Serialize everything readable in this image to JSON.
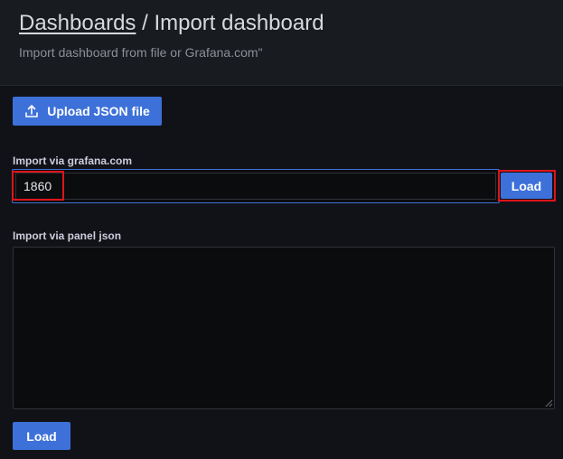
{
  "header": {
    "breadcrumb_link": "Dashboards",
    "separator": " / ",
    "page_title": "Import dashboard",
    "subtitle": "Import dashboard from file or Grafana.com\""
  },
  "upload": {
    "label": "Upload JSON file",
    "icon": "upload-icon"
  },
  "grafana_import": {
    "label": "Import via grafana.com",
    "value": "1860",
    "load_label": "Load"
  },
  "panel_json": {
    "label": "Import via panel json",
    "value": "",
    "load_label": "Load"
  },
  "colors": {
    "accent": "#3d71d9",
    "highlight": "#e0141b",
    "background": "#111217",
    "header_bg": "#181b1f"
  }
}
